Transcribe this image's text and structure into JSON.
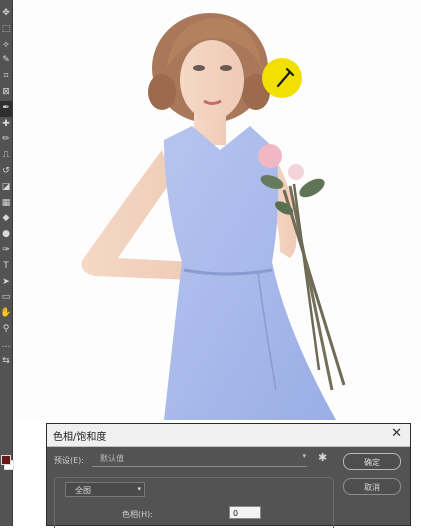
{
  "toolbar": {
    "tools": [
      {
        "name": "move-tool-icon",
        "glyph": "✥"
      },
      {
        "name": "marquee-tool-icon",
        "glyph": "⬚"
      },
      {
        "name": "lasso-tool-icon",
        "glyph": "⟡"
      },
      {
        "name": "quick-select-tool-icon",
        "glyph": "✎"
      },
      {
        "name": "crop-tool-icon",
        "glyph": "⌗"
      },
      {
        "name": "frame-tool-icon",
        "glyph": "⊠"
      },
      {
        "name": "eyedropper-tool-icon",
        "glyph": "✒"
      },
      {
        "name": "healing-brush-tool-icon",
        "glyph": "✚"
      },
      {
        "name": "brush-tool-icon",
        "glyph": "✏"
      },
      {
        "name": "clone-stamp-tool-icon",
        "glyph": "⎍"
      },
      {
        "name": "history-brush-tool-icon",
        "glyph": "↺"
      },
      {
        "name": "eraser-tool-icon",
        "glyph": "◪"
      },
      {
        "name": "gradient-tool-icon",
        "glyph": "▦"
      },
      {
        "name": "blur-tool-icon",
        "glyph": "◆"
      },
      {
        "name": "dodge-tool-icon",
        "glyph": "●"
      },
      {
        "name": "pen-tool-icon",
        "glyph": "✑"
      },
      {
        "name": "type-tool-icon",
        "glyph": "T"
      },
      {
        "name": "path-select-tool-icon",
        "glyph": "➤"
      },
      {
        "name": "rectangle-tool-icon",
        "glyph": "▭"
      },
      {
        "name": "hand-tool-icon",
        "glyph": "✋"
      },
      {
        "name": "zoom-tool-icon",
        "glyph": "⚲"
      },
      {
        "name": "more-tools-icon",
        "glyph": "…"
      },
      {
        "name": "swap-colors-icon",
        "glyph": "⇆"
      }
    ],
    "active_index": 6
  },
  "colors": {
    "foreground": "#6a1616",
    "background": "#ffffff",
    "eyedropper_highlight": "#f2e000"
  },
  "dialog": {
    "title": "色相/饱和度",
    "preset_label": "预设(E):",
    "preset_value": "默认值",
    "ok": "确定",
    "cancel": "取消",
    "channel_value": "全图",
    "hue_label": "色相(H):",
    "hue_value": "0"
  }
}
